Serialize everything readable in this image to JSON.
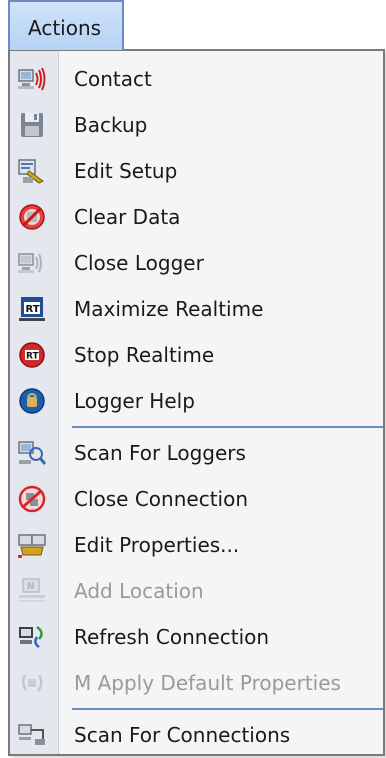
{
  "menu": {
    "title": "Actions"
  },
  "items": [
    {
      "label": "Contact",
      "icon": "computer-signal-icon",
      "enabled": true
    },
    {
      "label": "Backup",
      "icon": "floppy-disk-icon",
      "enabled": true
    },
    {
      "label": "Edit Setup",
      "icon": "edit-setup-icon",
      "enabled": true
    },
    {
      "label": "Clear Data",
      "icon": "clear-data-icon",
      "enabled": true
    },
    {
      "label": "Close Logger",
      "icon": "computer-signal-off-icon",
      "enabled": true
    },
    {
      "label": "Maximize Realtime",
      "icon": "realtime-window-icon",
      "enabled": true
    },
    {
      "label": "Stop Realtime",
      "icon": "stop-realtime-icon",
      "enabled": true
    },
    {
      "label": "Logger Help",
      "icon": "help-icon",
      "enabled": true
    },
    {
      "label": "Scan For Loggers",
      "icon": "scan-loggers-icon",
      "enabled": true
    },
    {
      "label": "Close Connection",
      "icon": "close-connection-icon",
      "enabled": true
    },
    {
      "label": "Edit Properties...",
      "icon": "edit-properties-icon",
      "enabled": true
    },
    {
      "label": "Add Location",
      "icon": "add-location-icon",
      "enabled": false
    },
    {
      "label": "Refresh Connection",
      "icon": "refresh-connection-icon",
      "enabled": true
    },
    {
      "label": "M Apply Default Properties",
      "icon": "apply-defaults-icon",
      "enabled": false
    },
    {
      "label": "Scan For Connections",
      "icon": "scan-connections-icon",
      "enabled": true
    }
  ]
}
